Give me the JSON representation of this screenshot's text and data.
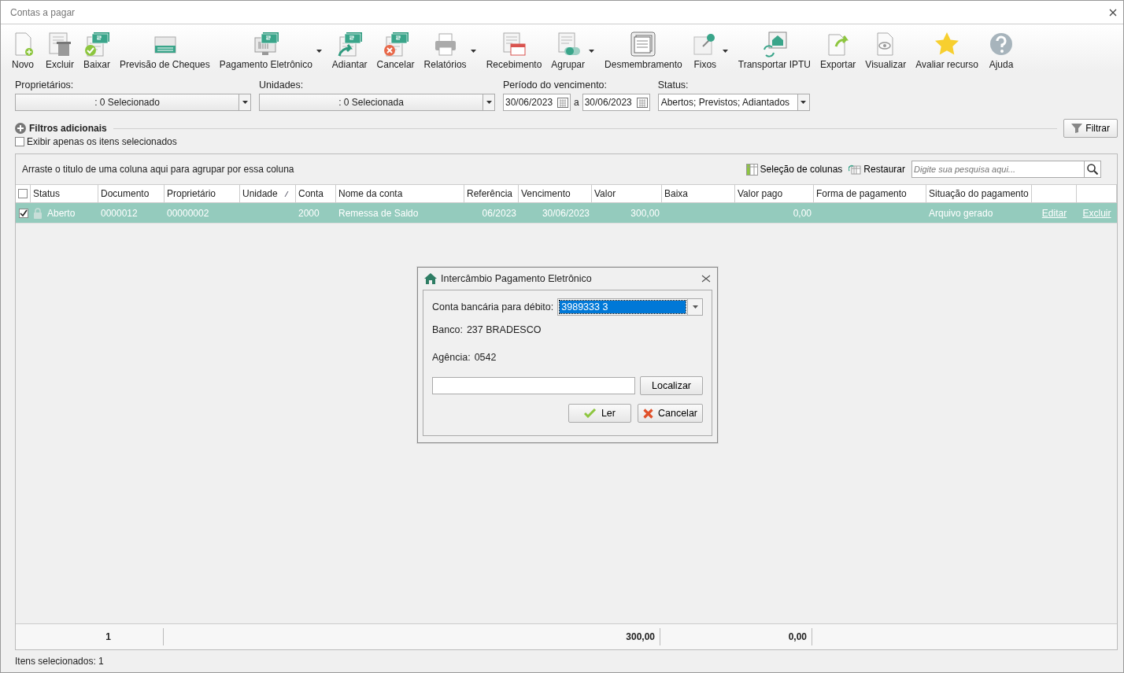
{
  "window": {
    "title": "Contas a pagar"
  },
  "toolbar": [
    {
      "label": "Novo",
      "dropdown": false
    },
    {
      "label": "Excluir",
      "dropdown": false
    },
    {
      "label": "Baixar",
      "dropdown": false
    },
    {
      "label": "Previsão de Cheques",
      "dropdown": false
    },
    {
      "label": "Pagamento Eletrônico",
      "dropdown": true
    },
    {
      "label": "Adiantar",
      "dropdown": false
    },
    {
      "label": "Cancelar",
      "dropdown": false
    },
    {
      "label": "Relatórios",
      "dropdown": true
    },
    {
      "label": "Recebimento",
      "dropdown": false
    },
    {
      "label": "Agrupar",
      "dropdown": true
    },
    {
      "label": "Desmembramento",
      "dropdown": false
    },
    {
      "label": "Fixos",
      "dropdown": true
    },
    {
      "label": "Transportar IPTU",
      "dropdown": false
    },
    {
      "label": "Exportar",
      "dropdown": false
    },
    {
      "label": "Visualizar",
      "dropdown": false
    },
    {
      "label": "Avaliar recurso",
      "dropdown": false
    },
    {
      "label": "Ajuda",
      "dropdown": false
    }
  ],
  "filters": {
    "proprietarios": {
      "label": "Proprietários:",
      "value": ": 0 Selecionado"
    },
    "unidades": {
      "label": "Unidades:",
      "value": ": 0 Selecionada"
    },
    "periodo": {
      "label": "Período do vencimento:",
      "from": "30/06/2023",
      "separator": "a",
      "to": "30/06/2023"
    },
    "status": {
      "label": "Status:",
      "value": "Abertos; Previstos; Adiantados"
    }
  },
  "additional_filters": {
    "label": "Filtros adicionais",
    "expanded": false
  },
  "filter_button": "Filtrar",
  "only_selected": {
    "label": "Exibir apenas os itens selecionados",
    "checked": false
  },
  "grid": {
    "group_hint": "Arraste o titulo de uma coluna aqui para agrupar por essa coluna",
    "column_selection": "Seleção de colunas",
    "restore": "Restaurar",
    "search": {
      "placeholder": "Digite sua pesquisa aqui..."
    },
    "header_checked": false,
    "columns": [
      {
        "label": "Status",
        "sort": false
      },
      {
        "label": "Documento",
        "sort": false
      },
      {
        "label": "Proprietário",
        "sort": false
      },
      {
        "label": "Unidade",
        "sort": true
      },
      {
        "label": "Conta",
        "sort": false
      },
      {
        "label": "Nome da conta",
        "sort": false
      },
      {
        "label": "Referência",
        "sort": false
      },
      {
        "label": "Vencimento",
        "sort": false
      },
      {
        "label": "Valor",
        "sort": false
      },
      {
        "label": "Baixa",
        "sort": false
      },
      {
        "label": "Valor pago",
        "sort": false
      },
      {
        "label": "Forma de pagamento",
        "sort": false
      },
      {
        "label": "Situação do pagamento",
        "sort": false
      }
    ],
    "rows": [
      {
        "selected": true,
        "checked": true,
        "locked": true,
        "cells": [
          "Aberto",
          "0000012",
          "00000002",
          "",
          "2000",
          "Remessa de Saldo",
          "06/2023",
          "30/06/2023",
          "300,00",
          "",
          "0,00",
          "",
          "Arquivo gerado"
        ],
        "edit": "Editar",
        "delete": "Excluir"
      }
    ],
    "totals": [
      "1",
      "300,00",
      "0,00"
    ]
  },
  "status_bar": "Itens selecionados: 1",
  "dialog": {
    "title": "Intercâmbio Pagamento Eletrônico",
    "account_label": "Conta bancária para débito:",
    "account_value": "3989333 3",
    "account_highlighted": true,
    "bank_label": "Banco:",
    "bank_value": "237 BRADESCO",
    "agency_label": "Agência:",
    "agency_value": "0542",
    "buttons": {
      "find": "Localizar",
      "read": "Ler",
      "cancel": "Cancelar"
    }
  }
}
